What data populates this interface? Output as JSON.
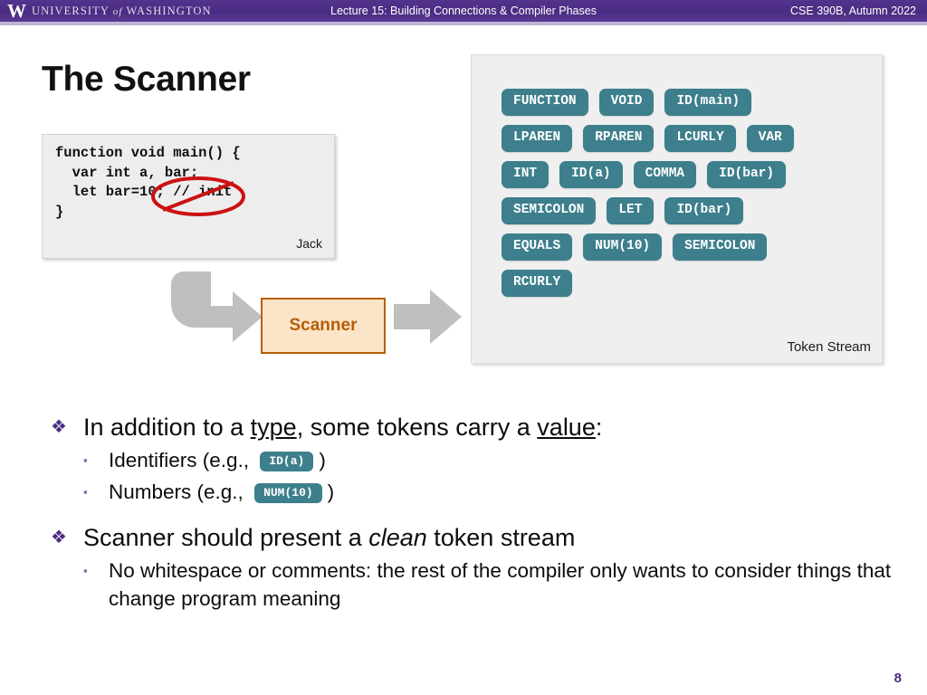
{
  "header": {
    "logo_w": "W",
    "university_pre": "UNIVERSITY",
    "university_of": "of",
    "university_post": "WASHINGTON",
    "lecture_title": "Lecture 15: Building Connections & Compiler Phases",
    "course": "CSE 390B, Autumn 2022",
    "band_color": "#4b2d83"
  },
  "slide": {
    "title": "The Scanner",
    "page_number": "8"
  },
  "code_card": {
    "code": "function void main() {\n  var int a, bar;\n  let bar=10; // init\n}",
    "author_label": "Jack",
    "strikethrough_target": "// init",
    "strike_color": "#cc1111"
  },
  "flow": {
    "scanner_label": "Scanner",
    "scanner_border_color": "#b45f06",
    "scanner_fill_color": "#fce4c8",
    "arrow_color": "#bfbfbf",
    "input_arrow": "bent-arrow-icon",
    "output_arrow": "right-arrow-icon"
  },
  "token_panel": {
    "caption": "Token Stream",
    "chip_color": "#3d7f8c",
    "rows": [
      [
        "FUNCTION",
        "VOID",
        "ID(main)"
      ],
      [
        "LPAREN",
        "RPAREN",
        "LCURLY",
        "VAR"
      ],
      [
        "INT",
        "ID(a)",
        "COMMA",
        "ID(bar)"
      ],
      [
        "SEMICOLON",
        "LET",
        "ID(bar)"
      ],
      [
        "EQUALS",
        "NUM(10)",
        "SEMICOLON"
      ],
      [
        "RCURLY"
      ]
    ]
  },
  "bullets": {
    "b1_pre": "In addition to a ",
    "b1_type": "type",
    "b1_mid": ", some tokens carry a ",
    "b1_value": "value",
    "b1_post": ":",
    "sub1_pre": "Identifiers (e.g., ",
    "sub1_chip": "ID(a)",
    "sub1_post": ")",
    "sub2_pre": "Numbers (e.g., ",
    "sub2_chip": "NUM(10)",
    "sub2_post": ")",
    "b2_pre": "Scanner should present a ",
    "b2_clean": "clean",
    "b2_post": " token stream",
    "sub3_line1": "No whitespace or comments: the rest of the compiler only wants",
    "sub3_line2": "to consider things that change program meaning",
    "diamond_marker": "❖",
    "square_marker": "▪"
  }
}
